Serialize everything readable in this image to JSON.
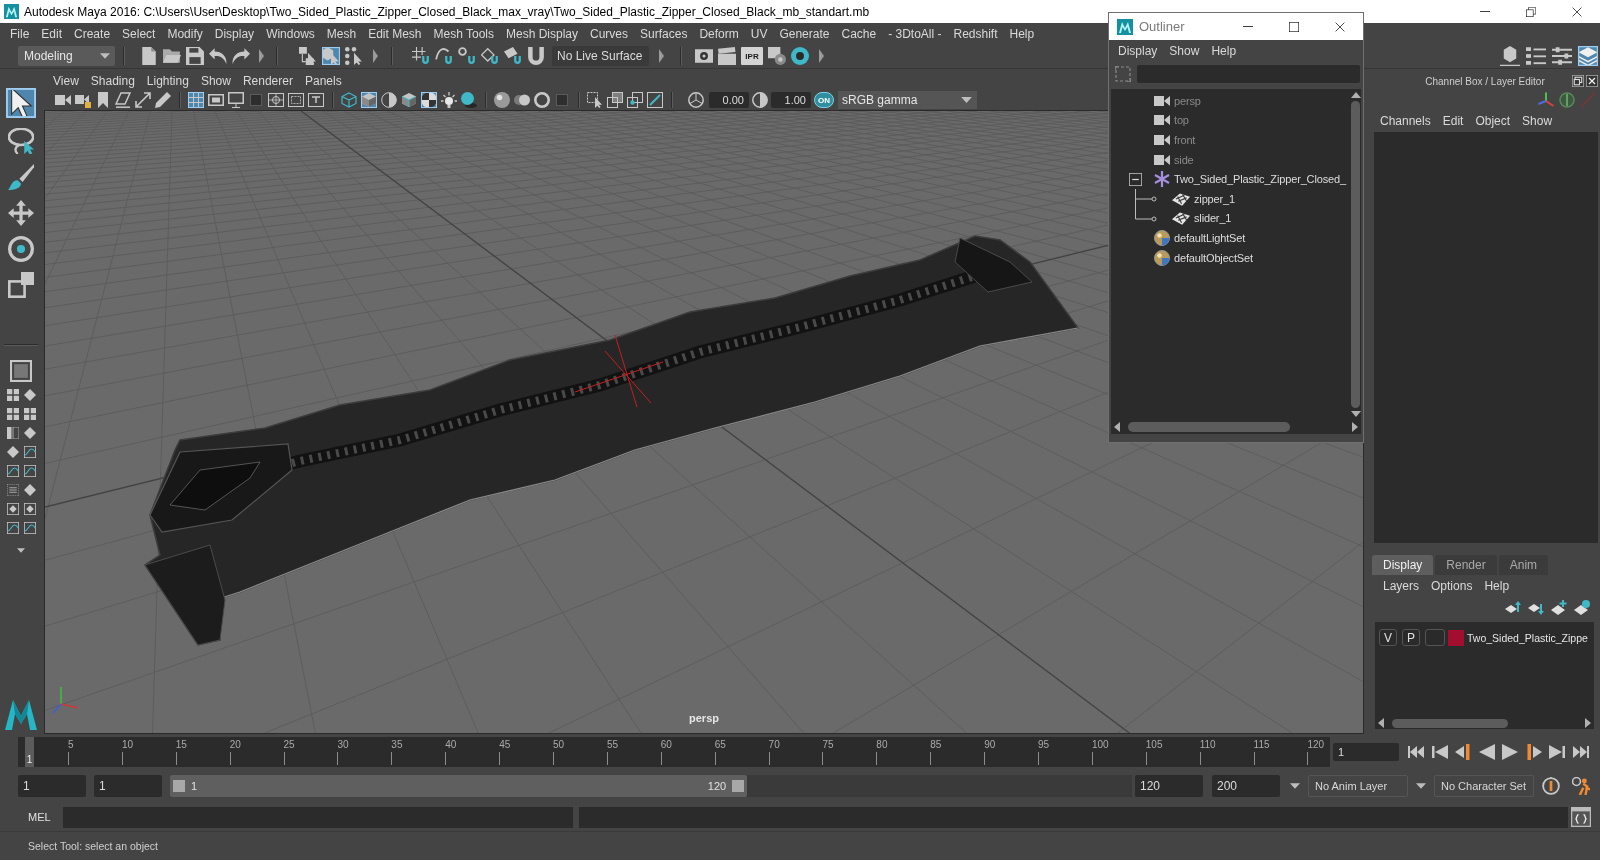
{
  "window": {
    "title": "Autodesk Maya 2016: C:\\Users\\User\\Desktop\\Two_Sided_Plastic_Zipper_Closed_Black_max_vray\\Two_Sided_Plastic_Zipper_Closed_Black_mb_standart.mb"
  },
  "menu_bar": [
    "File",
    "Edit",
    "Create",
    "Select",
    "Modify",
    "Display",
    "Windows",
    "Mesh",
    "Edit Mesh",
    "Mesh Tools",
    "Mesh Display",
    "Curves",
    "Surfaces",
    "Deform",
    "UV",
    "Generate",
    "Cache",
    "- 3DtoAll -",
    "Redshift",
    "Help"
  ],
  "status_line": {
    "menu_set": "Modeling",
    "selection_modes": [
      {
        "selected": false
      },
      {
        "selected": true
      },
      {
        "selected": false
      }
    ],
    "live_surface": "No Live Surface",
    "ipr_label": "IPR",
    "panel_buttons": [
      {
        "on": false
      },
      {
        "on": false
      },
      {
        "on": false
      },
      {
        "on": true
      }
    ]
  },
  "toolbox": {
    "tools": [
      {
        "selected": true
      },
      {
        "selected": false
      },
      {
        "selected": false
      },
      {
        "selected": false
      },
      {
        "selected": false
      },
      {
        "selected": false
      }
    ]
  },
  "viewport": {
    "menu": [
      "View",
      "Shading",
      "Lighting",
      "Show",
      "Renderer",
      "Panels"
    ],
    "toolbar_buttons": [
      {
        "on": false
      },
      {
        "on": false
      },
      {
        "on": false
      },
      {
        "on": false
      },
      {
        "on": false
      },
      {
        "on": false
      },
      {
        "on": true
      },
      {
        "on": false
      },
      {
        "on": false
      },
      {
        "on": false
      },
      {
        "on": false
      },
      {
        "on": false
      },
      {
        "on": false
      },
      {
        "on": false
      },
      {
        "on": true
      },
      {
        "on": false
      },
      {
        "on": false
      },
      {
        "on": true
      },
      {
        "on": false
      },
      {
        "on": false
      },
      {
        "on": false
      },
      {
        "on": false
      },
      {
        "on": false
      },
      {
        "on": false
      },
      {
        "on": false
      },
      {
        "on": false
      },
      {
        "on": false
      },
      {
        "on": false
      }
    ],
    "exposure": "0.00",
    "gamma": "1.00",
    "color_management": "ON",
    "color_space": "sRGB gamma",
    "camera_label": "persp"
  },
  "outliner": {
    "title": "Outliner",
    "menu": [
      "Display",
      "Show",
      "Help"
    ],
    "tree": [
      {
        "name": "persp",
        "kind": "camera",
        "dimmed": true
      },
      {
        "name": "top",
        "kind": "camera",
        "dimmed": true
      },
      {
        "name": "front",
        "kind": "camera",
        "dimmed": true
      },
      {
        "name": "side",
        "kind": "camera",
        "dimmed": true
      },
      {
        "name": "Two_Sided_Plastic_Zipper_Closed_",
        "kind": "group",
        "dimmed": false,
        "expanded": true,
        "children": [
          {
            "name": "zipper_1",
            "kind": "mesh",
            "dimmed": false
          },
          {
            "name": "slider_1",
            "kind": "mesh",
            "dimmed": false
          }
        ]
      },
      {
        "name": "defaultLightSet",
        "kind": "set",
        "dimmed": false
      },
      {
        "name": "defaultObjectSet",
        "kind": "set",
        "dimmed": false
      }
    ]
  },
  "channel_box": {
    "title": "Channel Box / Layer Editor",
    "menu": [
      "Channels",
      "Edit",
      "Object",
      "Show"
    ]
  },
  "layer_editor": {
    "tabs": [
      {
        "label": "Display",
        "selected": true
      },
      {
        "label": "Render",
        "selected": false
      },
      {
        "label": "Anim",
        "selected": false
      }
    ],
    "menu": [
      "Layers",
      "Options",
      "Help"
    ],
    "layers": [
      {
        "visibility": "V",
        "playback": "P",
        "color": "#a30d2e",
        "name": "Two_Sided_Plastic_Zippe"
      }
    ]
  },
  "time_slider": {
    "current_frame": "1",
    "ticks": [
      "5",
      "10",
      "15",
      "20",
      "25",
      "30",
      "35",
      "40",
      "45",
      "50",
      "55",
      "60",
      "65",
      "70",
      "75",
      "80",
      "85",
      "90",
      "95",
      "100",
      "105",
      "110",
      "115",
      "120"
    ],
    "frame_field": "1"
  },
  "range_slider": {
    "animation_start": "1",
    "playback_start": "1",
    "range_start": "1",
    "range_end": "120",
    "level": 0.6,
    "playback_end": "120",
    "animation_end": "200",
    "anim_layer": "No Anim Layer",
    "character_set": "No Character Set"
  },
  "command_line": {
    "language": "MEL"
  },
  "help_line": "Select Tool: select an object"
}
